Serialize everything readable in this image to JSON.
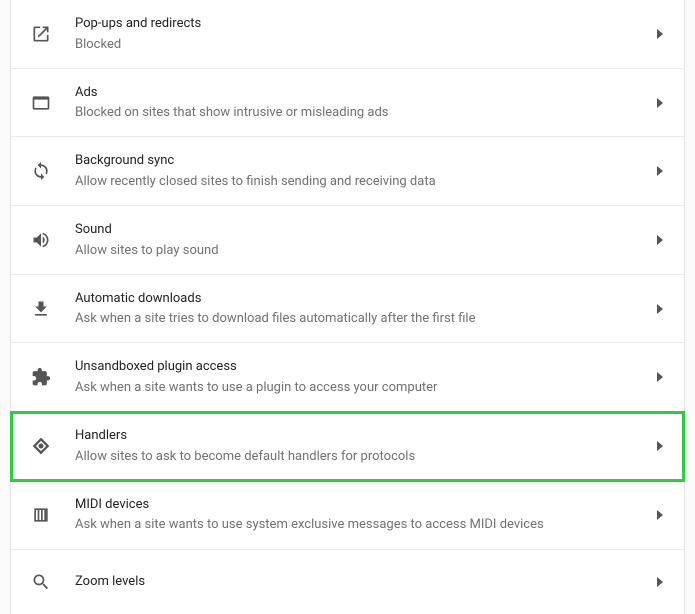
{
  "settings": [
    {
      "key": "popups",
      "icon": "open-in-new-icon",
      "title": "Pop-ups and redirects",
      "sub": "Blocked",
      "highlight": false
    },
    {
      "key": "ads",
      "icon": "window-icon",
      "title": "Ads",
      "sub": "Blocked on sites that show intrusive or misleading ads",
      "highlight": false
    },
    {
      "key": "bg-sync",
      "icon": "sync-icon",
      "title": "Background sync",
      "sub": "Allow recently closed sites to finish sending and receiving data",
      "highlight": false
    },
    {
      "key": "sound",
      "icon": "sound-icon",
      "title": "Sound",
      "sub": "Allow sites to play sound",
      "highlight": false
    },
    {
      "key": "downloads",
      "icon": "download-icon",
      "title": "Automatic downloads",
      "sub": "Ask when a site tries to download files automatically after the first file",
      "highlight": false
    },
    {
      "key": "plugin",
      "icon": "puzzle-icon",
      "title": "Unsandboxed plugin access",
      "sub": "Ask when a site wants to use a plugin to access your computer",
      "highlight": false
    },
    {
      "key": "handlers",
      "icon": "handlers-icon",
      "title": "Handlers",
      "sub": "Allow sites to ask to become default handlers for protocols",
      "highlight": true
    },
    {
      "key": "midi",
      "icon": "midi-icon",
      "title": "MIDI devices",
      "sub": "Ask when a site wants to use system exclusive messages to access MIDI devices",
      "highlight": false
    },
    {
      "key": "zoom",
      "icon": "zoom-icon",
      "title": "Zoom levels",
      "sub": "",
      "highlight": false
    }
  ]
}
